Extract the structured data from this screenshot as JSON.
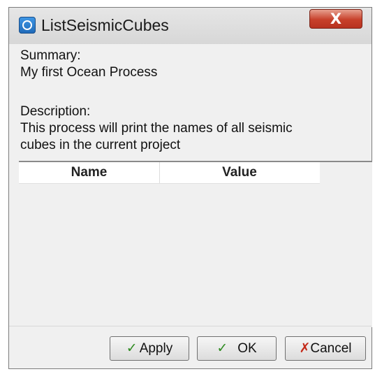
{
  "window": {
    "title": "ListSeismicCubes",
    "close_label": "X"
  },
  "summary": {
    "summary_label": "Summary:",
    "summary_text": "My first Ocean Process",
    "description_label": "Description:",
    "description_line1": "This process will print the names of all seismic",
    "description_line2": "cubes in the current project"
  },
  "grid": {
    "columns": [
      "Name",
      "Value"
    ],
    "rows": []
  },
  "buttons": {
    "apply": {
      "icon": "checkmark-icon",
      "label": "Apply"
    },
    "ok": {
      "icon": "checkmark-icon",
      "label": "OK"
    },
    "cancel": {
      "icon": "x-mark-icon",
      "label": "Cancel"
    }
  },
  "colors": {
    "close_button": "#c7402a",
    "ok_icon": "#2e8b20",
    "cancel_icon": "#c42a1a",
    "app_icon": "#2a7fd1"
  }
}
